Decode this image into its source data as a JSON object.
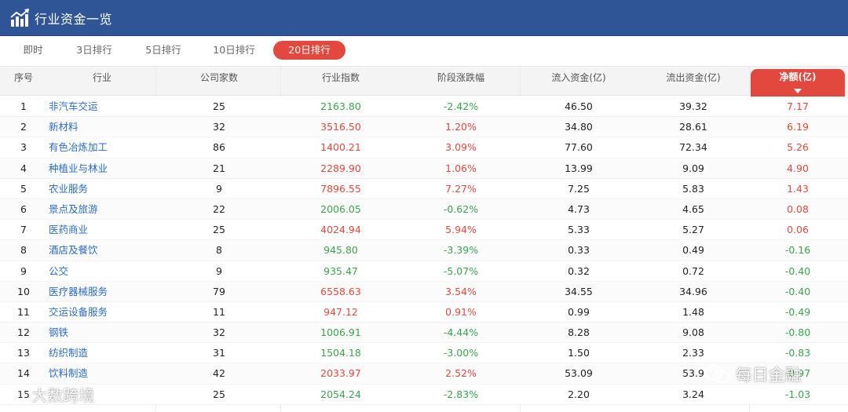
{
  "header": {
    "title": "行业资金一览"
  },
  "tabs": [
    {
      "label": "即时",
      "active": false
    },
    {
      "label": "3日排行",
      "active": false
    },
    {
      "label": "5日排行",
      "active": false
    },
    {
      "label": "10日排行",
      "active": false
    },
    {
      "label": "20日排行",
      "active": true
    }
  ],
  "columns": [
    "序号",
    "行业",
    "公司家数",
    "行业指数",
    "阶段涨跌幅",
    "流入资金(亿)",
    "流出资金(亿)",
    "净额(亿)"
  ],
  "sorted_column": "净额(亿)",
  "colors": {
    "header_bg": "#2f5597",
    "accent": "#e2483e",
    "up": "#e2483e",
    "down": "#3aa34e",
    "link": "#2a6cc4"
  },
  "rows": [
    {
      "rank": "1",
      "industry": "非汽车交运",
      "companies": "25",
      "index": "2163.80",
      "change": "-2.42%",
      "inflow": "46.50",
      "outflow": "39.32",
      "net": "7.17"
    },
    {
      "rank": "2",
      "industry": "新材料",
      "companies": "32",
      "index": "3516.50",
      "change": "1.20%",
      "inflow": "34.80",
      "outflow": "28.61",
      "net": "6.19"
    },
    {
      "rank": "3",
      "industry": "有色冶炼加工",
      "companies": "86",
      "index": "1400.21",
      "change": "3.09%",
      "inflow": "77.60",
      "outflow": "72.34",
      "net": "5.26"
    },
    {
      "rank": "4",
      "industry": "种植业与林业",
      "companies": "21",
      "index": "2289.90",
      "change": "1.06%",
      "inflow": "13.99",
      "outflow": "9.09",
      "net": "4.90"
    },
    {
      "rank": "5",
      "industry": "农业服务",
      "companies": "9",
      "index": "7896.55",
      "change": "7.27%",
      "inflow": "7.25",
      "outflow": "5.83",
      "net": "1.43"
    },
    {
      "rank": "6",
      "industry": "景点及旅游",
      "companies": "22",
      "index": "2006.05",
      "change": "-0.62%",
      "inflow": "4.73",
      "outflow": "4.65",
      "net": "0.08"
    },
    {
      "rank": "7",
      "industry": "医药商业",
      "companies": "25",
      "index": "4024.94",
      "change": "5.94%",
      "inflow": "5.33",
      "outflow": "5.27",
      "net": "0.06"
    },
    {
      "rank": "8",
      "industry": "酒店及餐饮",
      "companies": "8",
      "index": "945.80",
      "change": "-3.39%",
      "inflow": "0.33",
      "outflow": "0.49",
      "net": "-0.16"
    },
    {
      "rank": "9",
      "industry": "公交",
      "companies": "9",
      "index": "935.47",
      "change": "-5.07%",
      "inflow": "0.32",
      "outflow": "0.72",
      "net": "-0.40"
    },
    {
      "rank": "10",
      "industry": "医疗器械服务",
      "companies": "79",
      "index": "6558.63",
      "change": "3.54%",
      "inflow": "34.55",
      "outflow": "34.96",
      "net": "-0.40"
    },
    {
      "rank": "11",
      "industry": "交运设备服务",
      "companies": "11",
      "index": "947.12",
      "change": "0.91%",
      "inflow": "0.99",
      "outflow": "1.48",
      "net": "-0.49"
    },
    {
      "rank": "12",
      "industry": "钢铁",
      "companies": "32",
      "index": "1006.91",
      "change": "-4.44%",
      "inflow": "8.28",
      "outflow": "9.08",
      "net": "-0.80"
    },
    {
      "rank": "13",
      "industry": "纺织制造",
      "companies": "31",
      "index": "1504.18",
      "change": "-3.00%",
      "inflow": "1.50",
      "outflow": "2.33",
      "net": "-0.83"
    },
    {
      "rank": "14",
      "industry": "饮料制造",
      "companies": "42",
      "index": "2033.97",
      "change": "2.52%",
      "inflow": "53.09",
      "outflow": "53.9",
      "net": "-0.97"
    },
    {
      "rank": "15",
      "industry": "",
      "companies": "25",
      "index": "2054.24",
      "change": "-2.83%",
      "inflow": "2.20",
      "outflow": "3.24",
      "net": "-1.03"
    }
  ],
  "watermarks": {
    "left": "大数跨境",
    "right": "每日金融"
  }
}
